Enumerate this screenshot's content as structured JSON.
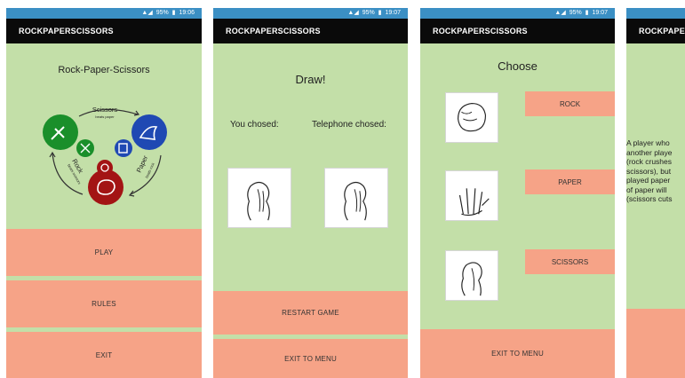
{
  "status": {
    "p1_time": "19:06",
    "p2_time": "19:07",
    "p3_time": "19:07",
    "battery": "95%"
  },
  "app_title": "ROCKPAPERSCISSORS",
  "screen1": {
    "heading": "Rock-Paper-Scissors",
    "diagram": {
      "scissors": "Scissors",
      "scissors_sub": "beats paper",
      "paper": "Paper",
      "paper_sub": "beats rock",
      "rock": "Rock",
      "rock_sub": "beats scissors"
    },
    "buttons": [
      "PLAY",
      "RULES",
      "EXIT"
    ]
  },
  "screen2": {
    "heading": "Draw!",
    "you_chosed": "You chosed:",
    "phone_chosed": "Telephone chosed:",
    "buttons": [
      "RESTART GAME",
      "EXIT TO MENU"
    ]
  },
  "screen3": {
    "heading": "Choose",
    "choices": [
      "ROCK",
      "PAPER",
      "SCISSORS"
    ],
    "exit": "EXIT TO MENU"
  },
  "screen4": {
    "title": "ROCKPAPERSCISSORS",
    "rules_lines": [
      "A player who",
      "another playe",
      "(rock crushes",
      "scissors), but",
      "played paper",
      "of paper will",
      "(scissors cuts"
    ]
  },
  "colors": {
    "status_bar": "#3b8fc4",
    "toolbar": "#0a0a0a",
    "background": "#c3dfa8",
    "button": "#f6a387",
    "green_circle": "#1a8f2a",
    "blue_circle": "#1f49b3",
    "red_circle": "#a31414"
  }
}
